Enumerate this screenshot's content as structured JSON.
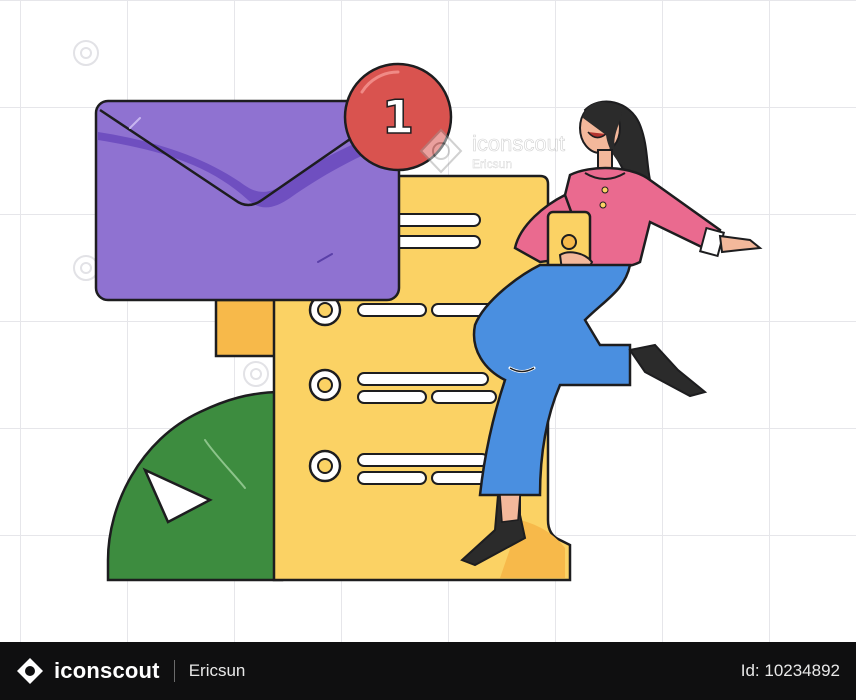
{
  "badge": {
    "count": "1",
    "color": "#d9534f"
  },
  "colors": {
    "envelope": "#8f72d1",
    "envelope_dark": "#6f4fc0",
    "document": "#fbd264",
    "document_back": "#f7b94a",
    "leaf": "#3d8c3f",
    "sweater": "#ea6a8f",
    "jeans": "#4a8fe0",
    "hair": "#2b2b2b",
    "outline": "#1d1d1f"
  },
  "watermark": {
    "brand": "iconscout",
    "author": "Ericsun"
  },
  "footer": {
    "brand": "iconscout",
    "author": "Ericsun",
    "asset_id": "Id: 10234892"
  }
}
